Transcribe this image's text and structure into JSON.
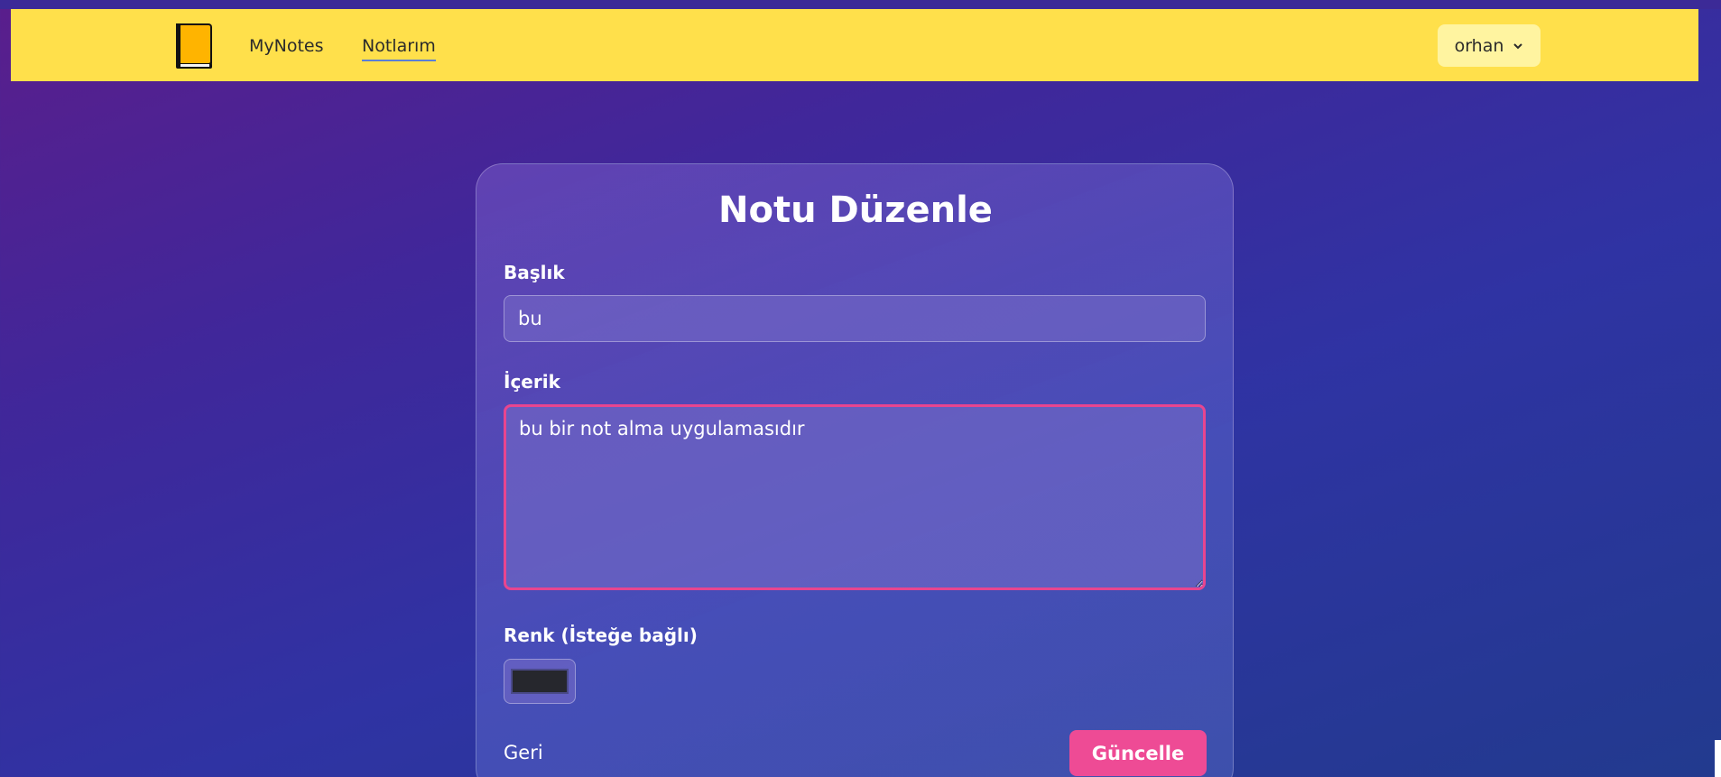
{
  "navbar": {
    "brand_label": "MyNotes",
    "notes_label": "Notlarım",
    "user_label": "orhan",
    "logo_icon": "notebook-icon",
    "user_chevron_icon": "chevron-down-icon",
    "bg_color": "#ffe04b"
  },
  "form": {
    "title": "Notu Düzenle",
    "title_label": "Başlık",
    "title_value": "bu",
    "content_label": "İçerik",
    "content_value": "bu bir not alma uygulamasıdır",
    "color_label": "Renk (İsteğe bağlı)",
    "color_value": "#26272d",
    "back_label": "Geri",
    "submit_label": "Güncelle",
    "accent_color": "#ee4b95"
  }
}
